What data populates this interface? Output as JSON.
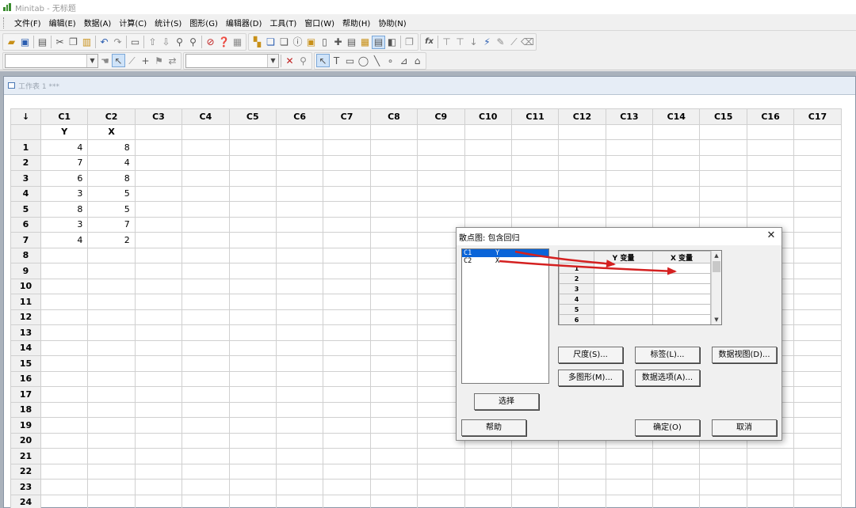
{
  "window": {
    "title": "Minitab - 无标题"
  },
  "menu": [
    "文件(F)",
    "编辑(E)",
    "数据(A)",
    "计算(C)",
    "统计(S)",
    "图形(G)",
    "编辑器(D)",
    "工具(T)",
    "窗口(W)",
    "帮助(H)",
    "协助(N)"
  ],
  "worksheet": {
    "title": "工作表 1 ***",
    "corner": "↓",
    "columns": [
      "C1",
      "C2",
      "C3",
      "C4",
      "C5",
      "C6",
      "C7",
      "C8",
      "C9",
      "C10",
      "C11",
      "C12",
      "C13",
      "C14",
      "C15",
      "C16",
      "C17"
    ],
    "names": [
      "Y",
      "X"
    ],
    "rows": [
      "1",
      "2",
      "3",
      "4",
      "5",
      "6",
      "7",
      "8",
      "9",
      "10",
      "11",
      "12",
      "13",
      "14",
      "15",
      "16",
      "17",
      "18",
      "19",
      "20",
      "21",
      "22",
      "23",
      "24"
    ],
    "cells": [
      [
        "4",
        "8"
      ],
      [
        "7",
        "4"
      ],
      [
        "6",
        "8"
      ],
      [
        "3",
        "5"
      ],
      [
        "8",
        "5"
      ],
      [
        "3",
        "7"
      ],
      [
        "4",
        "2"
      ]
    ]
  },
  "dialog": {
    "title": "散点图: 包含回归",
    "close": "✕",
    "variables": [
      [
        "C1",
        "Y"
      ],
      [
        "C2",
        "X"
      ]
    ],
    "table_headers": [
      "Y 变量",
      "X 变量"
    ],
    "table_rows": [
      "1",
      "2",
      "3",
      "4",
      "5",
      "6"
    ],
    "buttons": {
      "scale": "尺度(S)...",
      "labels": "标签(L)...",
      "data_view": "数据视图(D)...",
      "multiple_graphs": "多图形(M)...",
      "data_options": "数据选项(A)...",
      "select": "选择",
      "help": "帮助",
      "ok": "确定(O)",
      "cancel": "取消"
    },
    "arrow_color": "#d42020"
  }
}
